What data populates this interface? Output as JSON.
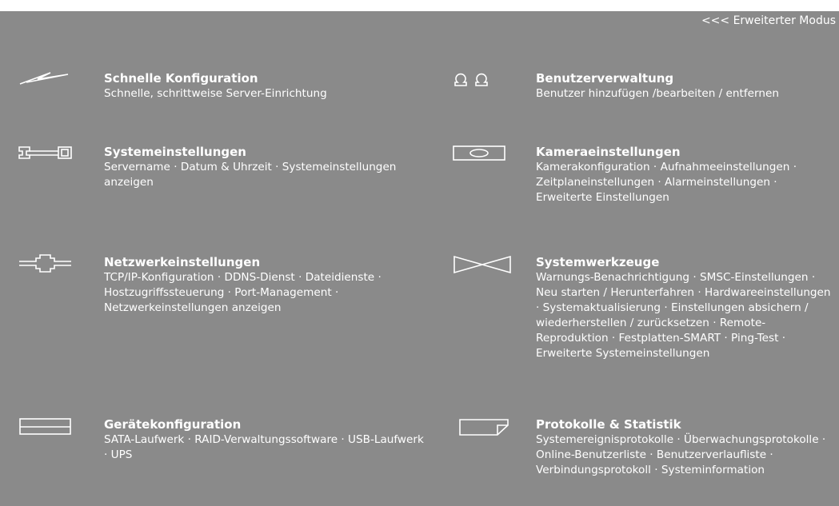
{
  "header": {
    "mode_link": "<<< Erweiterter Modus"
  },
  "menu": [
    {
      "title": "Schnelle Konfiguration",
      "description": "Schnelle, schrittweise Server-Einrichtung",
      "icon": "lightning-bolt-icon"
    },
    {
      "title": "Benutzerverwaltung",
      "description": "Benutzer hinzufügen /bearbeiten / entfernen",
      "icon": "users-icon"
    },
    {
      "title": "Systemeinstellungen",
      "description": "Servername · Datum & Uhrzeit · Systemeinstellungen anzeigen",
      "icon": "server-icon"
    },
    {
      "title": "Kameraeinstellungen",
      "description": "Kamerakonfiguration · Aufnahmeeinstellungen · Zeitplaneinstellungen · Alarmeinstellungen · Erweiterte Einstellungen",
      "icon": "camera-icon"
    },
    {
      "title": "Netzwerkeinstellungen",
      "description": "TCP/IP-Konfiguration · DDNS-Dienst · Dateidienste · Hostzugriffssteuerung · Port-Management · Netzwerkeinstellungen anzeigen",
      "icon": "network-icon"
    },
    {
      "title": "Systemwerkzeuge",
      "description": "Warnungs-Benachrichtigung · SMSC-Einstellungen · Neu starten / Herunterfahren · Hardwareeinstellungen · Systemaktualisierung · Einstellungen absichern / wiederherstellen / zurücksetzen · Remote-Reproduktion · Festplatten-SMART · Ping-Test · Erweiterte Systemeinstellungen",
      "icon": "tools-icon"
    },
    {
      "title": "Gerätekonfiguration",
      "description": "SATA-Laufwerk · RAID-Verwaltungssoftware · USB-Laufwerk · UPS",
      "icon": "disk-drive-icon"
    },
    {
      "title": "Protokolle & Statistik",
      "description": "Systemereignisprotokolle · Überwachungsprotokolle · Online-Benutzerliste · Benutzerverlaufliste · Verbindungsprotokoll · Systeminformation",
      "icon": "log-document-icon"
    }
  ]
}
